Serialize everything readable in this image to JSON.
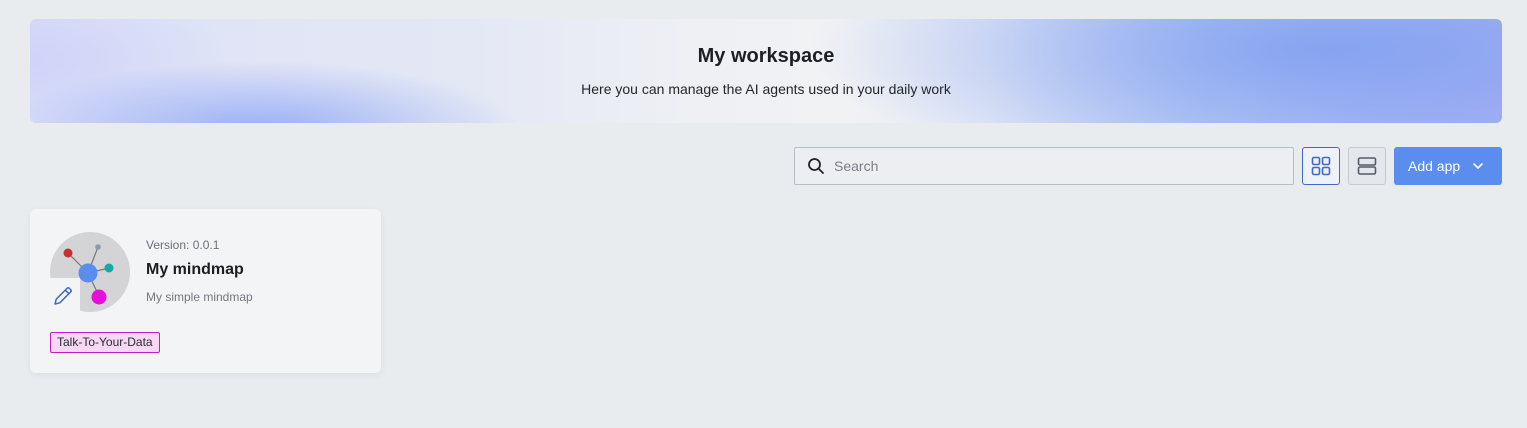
{
  "banner": {
    "title": "My workspace",
    "subtitle": "Here you can manage the AI agents used in your daily work"
  },
  "toolbar": {
    "search_placeholder": "Search",
    "search_icon": "search-icon",
    "grid_view_icon": "grid-view-icon",
    "list_view_icon": "list-view-icon",
    "add_app_label": "Add app",
    "add_app_icon": "chevron-down-icon",
    "active_view": "grid"
  },
  "apps": [
    {
      "version": "Version: 0.0.1",
      "name": "My mindmap",
      "description": "My simple mindmap",
      "tag": "Talk-To-Your-Data",
      "icon": "mindmap-icon",
      "edit_icon": "pencil-icon"
    }
  ],
  "colors": {
    "accent": "#5b8def",
    "active_border": "#3f68c8",
    "tag_border": "#c21ec2",
    "tag_background": "#f7d8f4",
    "page_background": "#e9ecef"
  }
}
